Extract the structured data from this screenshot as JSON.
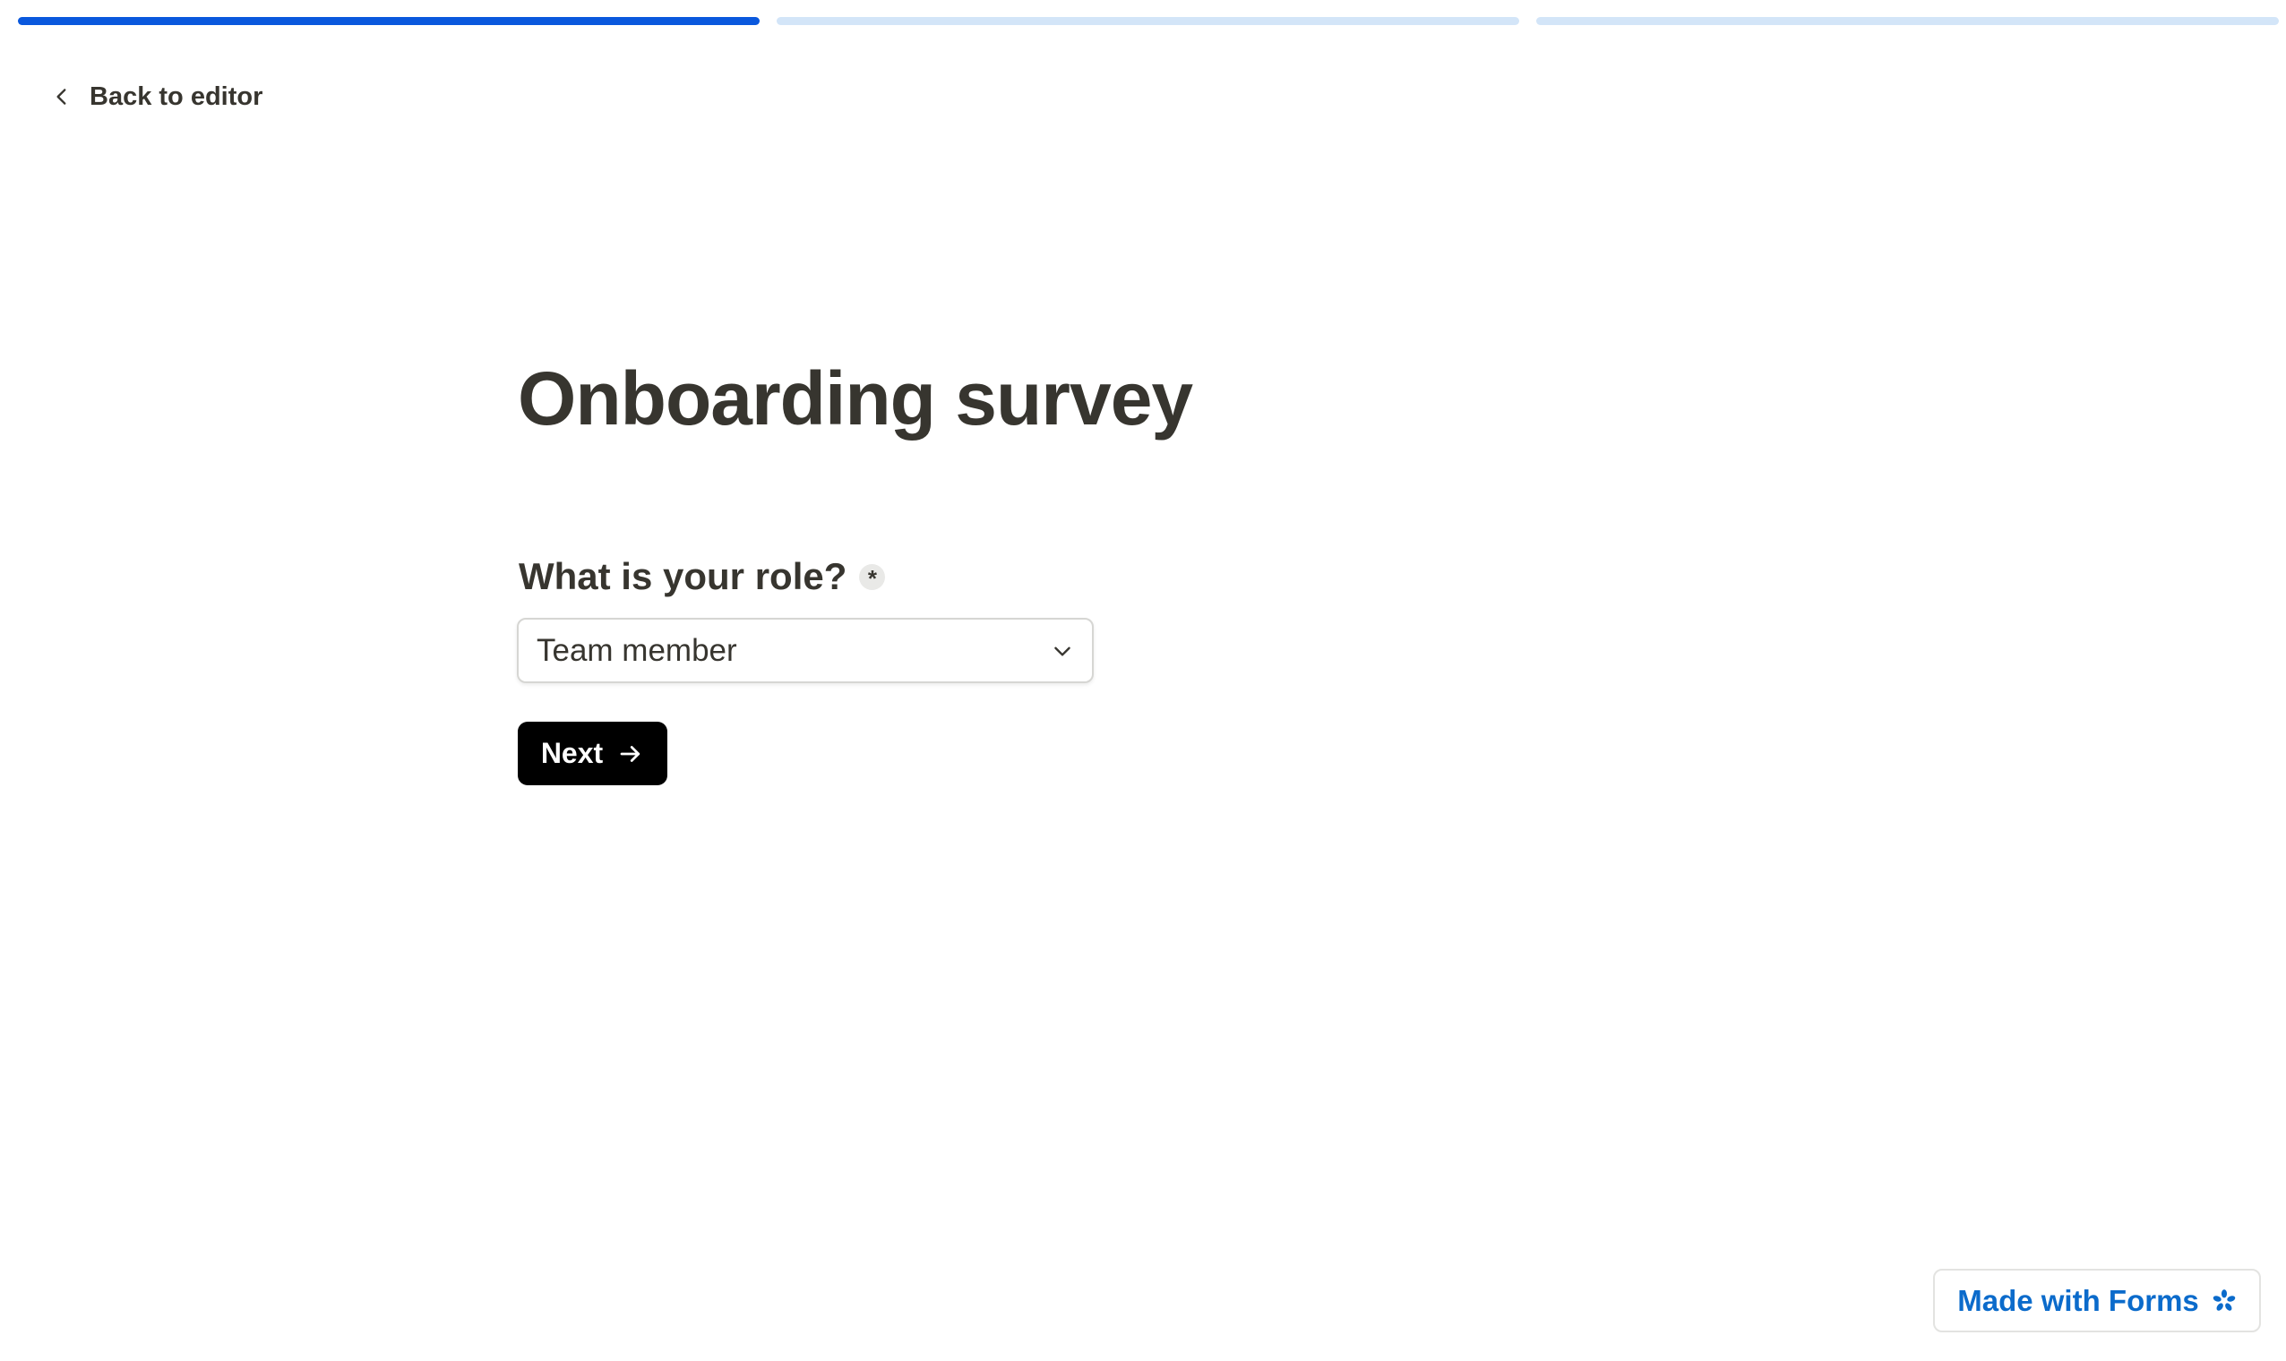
{
  "progress": {
    "steps_total": 3,
    "current_step": 1,
    "active_color": "#0a58dd",
    "inactive_color": "#d3e5f8"
  },
  "nav": {
    "back_label": "Back to editor",
    "back_icon": "chevron-left-icon"
  },
  "form": {
    "title": "Onboarding survey",
    "question": {
      "label": "What is your role?",
      "required_marker": "*",
      "selected_value": "Team member",
      "dropdown_icon": "chevron-down-icon"
    },
    "next_button": {
      "label": "Next",
      "icon": "arrow-right-icon",
      "background": "#000000"
    }
  },
  "footer": {
    "badge_label": "Made with Forms",
    "badge_icon": "asterisk-flower-icon",
    "brand_color": "#0b6bcb"
  }
}
